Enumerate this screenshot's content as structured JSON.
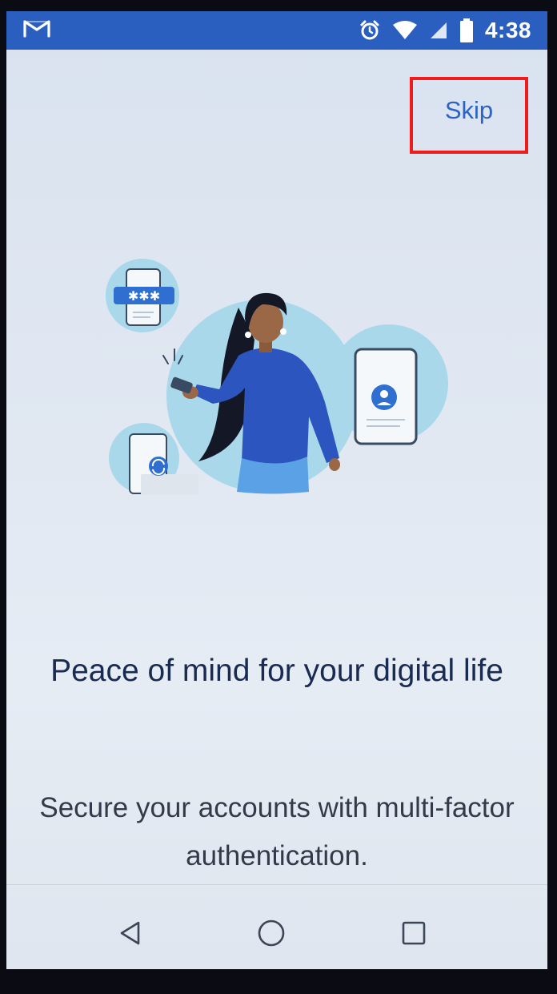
{
  "status_bar": {
    "app_icon": "gmail-m-icon",
    "icons": [
      "alarm-icon",
      "wifi-icon",
      "signal-icon",
      "battery-icon"
    ],
    "time": "4:38",
    "color": "#2a5fbf"
  },
  "header": {
    "skip_label": "Skip",
    "skip_highlight_color": "#ef1c1c"
  },
  "illustration": {
    "icon": "woman-with-phone-security-illustration"
  },
  "content": {
    "headline": "Peace of mind for your digital life",
    "subtitle": "Secure your accounts with multi-factor authentication."
  },
  "nav_bar": {
    "buttons": [
      "back-icon",
      "home-icon",
      "recents-icon"
    ]
  },
  "colors": {
    "accent": "#2c63c4",
    "headline": "#1a2b52",
    "background": "#e1e8f2"
  }
}
